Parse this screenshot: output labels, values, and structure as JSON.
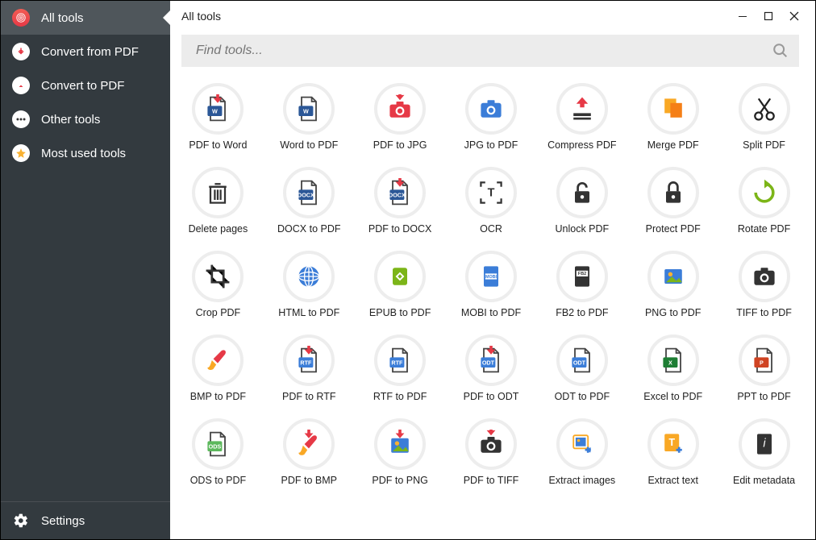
{
  "window": {
    "title": "All tools"
  },
  "search": {
    "placeholder": "Find tools..."
  },
  "sidebar": {
    "items": [
      {
        "label": "All tools",
        "icon": "spiral",
        "active": true
      },
      {
        "label": "Convert from PDF",
        "icon": "arrow-down",
        "active": false
      },
      {
        "label": "Convert to PDF",
        "icon": "arrow-up",
        "active": false
      },
      {
        "label": "Other tools",
        "icon": "dots",
        "active": false
      },
      {
        "label": "Most used tools",
        "icon": "star",
        "active": false
      }
    ],
    "settings_label": "Settings"
  },
  "tools": [
    {
      "label": "PDF to Word",
      "icon": "word-down"
    },
    {
      "label": "Word to PDF",
      "icon": "word"
    },
    {
      "label": "PDF to JPG",
      "icon": "camera-down"
    },
    {
      "label": "JPG to PDF",
      "icon": "camera-blue"
    },
    {
      "label": "Compress PDF",
      "icon": "compress"
    },
    {
      "label": "Merge PDF",
      "icon": "merge"
    },
    {
      "label": "Split PDF",
      "icon": "scissors"
    },
    {
      "label": "Delete pages",
      "icon": "trash"
    },
    {
      "label": "DOCX to PDF",
      "icon": "docx"
    },
    {
      "label": "PDF to DOCX",
      "icon": "docx-down"
    },
    {
      "label": "OCR",
      "icon": "ocr"
    },
    {
      "label": "Unlock PDF",
      "icon": "unlock"
    },
    {
      "label": "Protect PDF",
      "icon": "lock"
    },
    {
      "label": "Rotate PDF",
      "icon": "rotate"
    },
    {
      "label": "Crop PDF",
      "icon": "crop"
    },
    {
      "label": "HTML to PDF",
      "icon": "globe"
    },
    {
      "label": "EPUB to PDF",
      "icon": "epub"
    },
    {
      "label": "MOBI to PDF",
      "icon": "mobi"
    },
    {
      "label": "FB2 to PDF",
      "icon": "fb2"
    },
    {
      "label": "PNG to PDF",
      "icon": "png"
    },
    {
      "label": "TIFF to PDF",
      "icon": "camera-dark"
    },
    {
      "label": "BMP to PDF",
      "icon": "brush"
    },
    {
      "label": "PDF to RTF",
      "icon": "rtf-down"
    },
    {
      "label": "RTF to PDF",
      "icon": "rtf"
    },
    {
      "label": "PDF to ODT",
      "icon": "odt-down"
    },
    {
      "label": "ODT to PDF",
      "icon": "odt"
    },
    {
      "label": "Excel to PDF",
      "icon": "excel"
    },
    {
      "label": "PPT to PDF",
      "icon": "ppt"
    },
    {
      "label": "ODS to PDF",
      "icon": "ods"
    },
    {
      "label": "PDF to BMP",
      "icon": "brush-down"
    },
    {
      "label": "PDF to PNG",
      "icon": "png-down"
    },
    {
      "label": "PDF to TIFF",
      "icon": "camera-down2"
    },
    {
      "label": "Extract images",
      "icon": "extract-img"
    },
    {
      "label": "Extract text",
      "icon": "extract-txt"
    },
    {
      "label": "Edit metadata",
      "icon": "metadata"
    }
  ]
}
